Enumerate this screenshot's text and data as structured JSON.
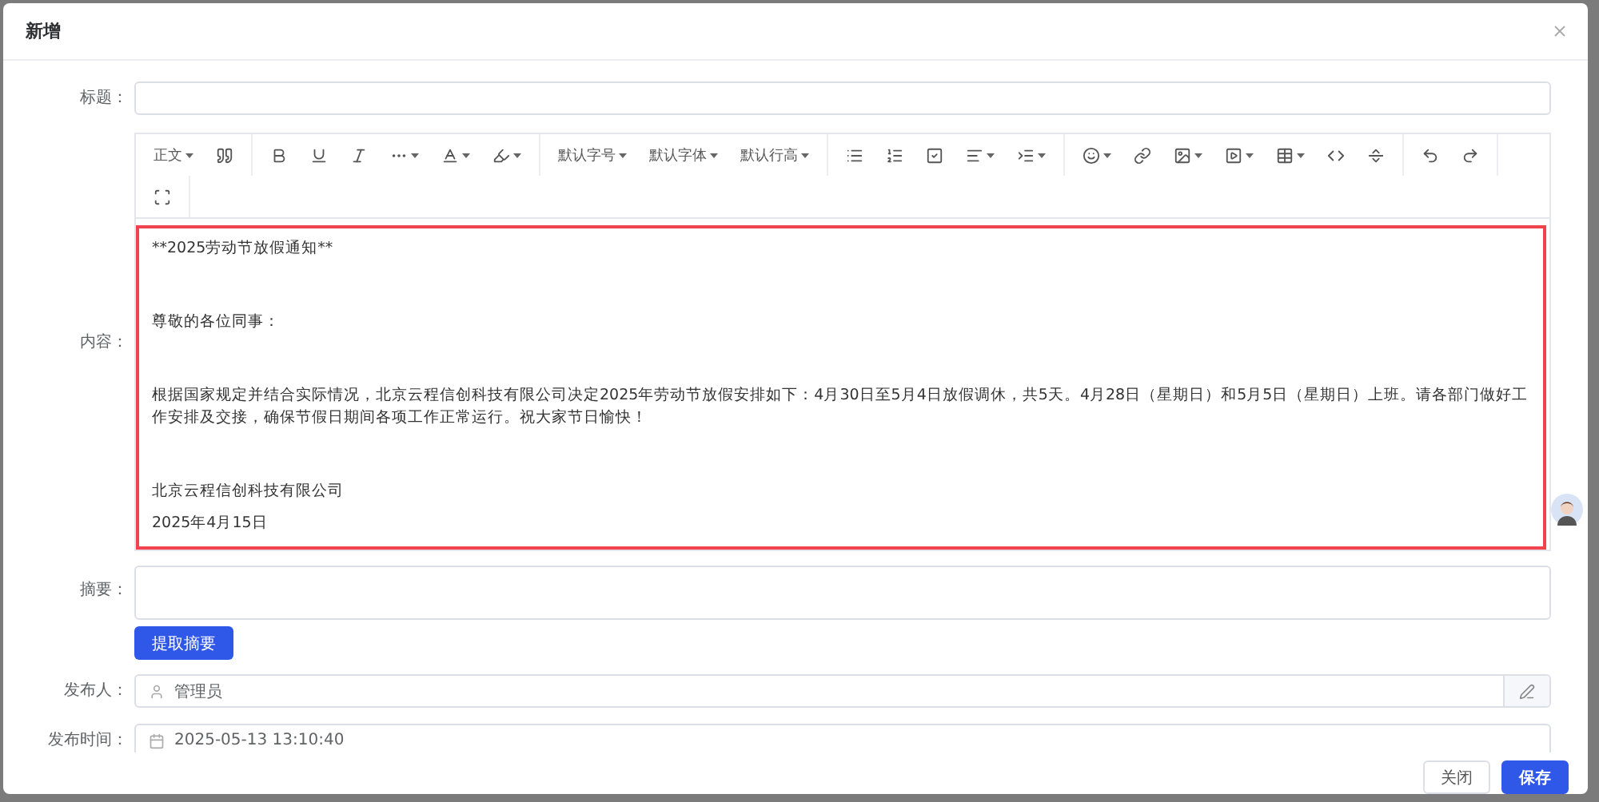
{
  "dialog": {
    "title": "新增"
  },
  "title_field": {
    "label": "标题："
  },
  "editor": {
    "label": "内容：",
    "invalid": true,
    "toolbar": [
      [
        {
          "items": [
            {
              "kind": "text",
              "label": "正文",
              "dropdown": true
            },
            {
              "kind": "icon",
              "dropdown": false
            }
          ]
        },
        {
          "items": [
            {
              "kind": "icon",
              "dropdown": false
            },
            {
              "kind": "icon",
              "dropdown": false
            },
            {
              "kind": "icon",
              "dropdown": false
            },
            {
              "kind": "icon",
              "dropdown": true
            },
            {
              "kind": "icon",
              "dropdown": true
            },
            {
              "kind": "icon",
              "dropdown": true
            }
          ]
        },
        {
          "items": [
            {
              "kind": "text",
              "label": "默认字号",
              "dropdown": true
            },
            {
              "kind": "text",
              "label": "默认字体",
              "dropdown": true
            },
            {
              "kind": "text",
              "label": "默认行高",
              "dropdown": true
            }
          ]
        },
        {
          "items": [
            {
              "kind": "icon",
              "dropdown": false
            },
            {
              "kind": "icon",
              "dropdown": false
            },
            {
              "kind": "icon",
              "dropdown": false
            },
            {
              "kind": "icon",
              "dropdown": true
            },
            {
              "kind": "icon",
              "dropdown": true
            }
          ]
        },
        {
          "items": [
            {
              "kind": "icon",
              "dropdown": true
            },
            {
              "kind": "icon",
              "dropdown": false
            },
            {
              "kind": "icon",
              "dropdown": true
            },
            {
              "kind": "icon",
              "dropdown": true
            },
            {
              "kind": "icon",
              "dropdown": true
            },
            {
              "kind": "icon",
              "dropdown": false
            },
            {
              "kind": "icon",
              "dropdown": false
            }
          ]
        },
        {
          "items": [
            {
              "kind": "icon",
              "dropdown": false
            },
            {
              "kind": "icon",
              "dropdown": false
            }
          ]
        }
      ],
      [
        {
          "items": [
            {
              "kind": "icon",
              "dropdown": false
            }
          ]
        }
      ]
    ],
    "paragraphs": [
      "**2025劳动节放假通知**",
      "尊敬的各位同事：",
      "根据国家规定并结合实际情况，北京云程信创科技有限公司决定2025年劳动节放假安排如下：4月30日至5月4日放假调休，共5天。4月28日（星期日）和5月5日（星期日）上班。请各部门做好工作安排及交接，确保节假日期间各项工作正常运行。祝大家节日愉快！",
      "北京云程信创科技有限公司",
      "2025年4月15日"
    ]
  },
  "summary": {
    "label": "摘要：",
    "button": "提取摘要"
  },
  "publisher": {
    "label": "发布人：",
    "value": "管理员"
  },
  "publish_time": {
    "label": "发布时间：",
    "value": "2025-05-13 13:10:40"
  },
  "footer": [
    {
      "label": "关闭",
      "kind": "default"
    },
    {
      "label": "保存",
      "kind": "primary"
    }
  ]
}
